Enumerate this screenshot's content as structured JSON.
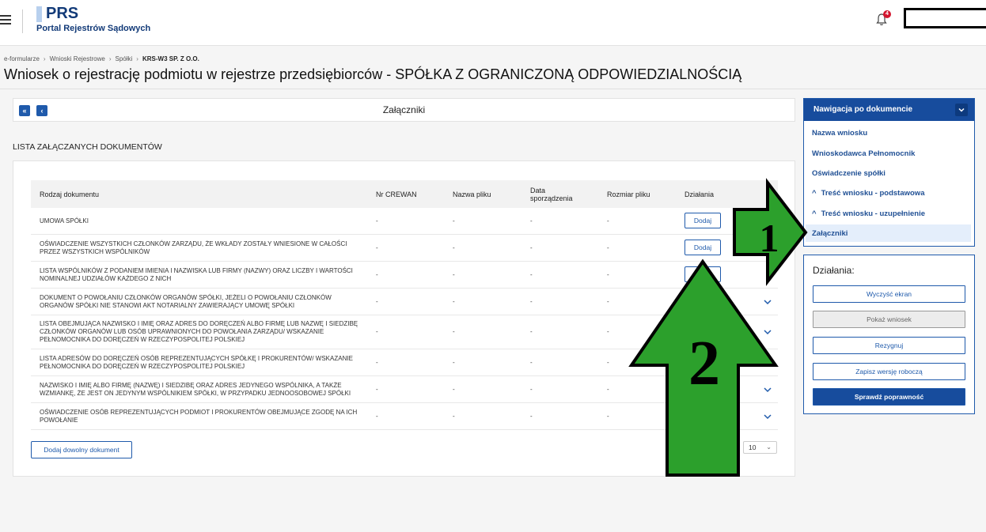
{
  "header": {
    "logo_title": "PRS",
    "logo_subtitle": "Portal Rejestrów Sądowych",
    "notification_count": "4"
  },
  "breadcrumb": [
    "e-formularze",
    "Wnioski Rejestrowe",
    "Spółki",
    "KRS-W3 SP. Z O.O."
  ],
  "page_title": "Wniosek o rejestrację podmiotu w rejestrze przedsiębiorców - SPÓŁKA Z OGRANICZONĄ ODPOWIEDZIALNOŚCIĄ",
  "section": {
    "title": "Załączniki",
    "first_icon": "«",
    "prev_icon": "‹"
  },
  "list_heading": "LISTA ZAŁĄCZANYCH DOKUMENTÓW",
  "table": {
    "columns": [
      "Rodzaj dokumentu",
      "Nr CREWAN",
      "Nazwa pliku",
      "Data sporządzenia",
      "Rozmiar pliku",
      "Działania"
    ],
    "add_label": "Dodaj",
    "rows": [
      {
        "name": "UMOWA SPÓŁKI",
        "crewan": "-",
        "file": "-",
        "date": "-",
        "size": "-"
      },
      {
        "name": "OŚWIADCZENIE WSZYSTKICH CZŁONKÓW ZARZĄDU, ŻE WKŁADY ZOSTAŁY WNIESIONE W CAŁOŚCI PRZEZ WSZYSTKICH WSPÓLNIKÓW",
        "crewan": "-",
        "file": "-",
        "date": "-",
        "size": "-"
      },
      {
        "name": "LISTA WSPÓLNIKÓW Z PODANIEM IMIENIA I NAZWISKA LUB FIRMY (NAZWY) ORAZ LICZBY I WARTOŚCI NOMINALNEJ UDZIAŁÓW KAŻDEGO Z NICH",
        "crewan": "-",
        "file": "-",
        "date": "-",
        "size": "-"
      },
      {
        "name": "DOKUMENT O POWOŁANIU CZŁONKÓW ORGANÓW SPÓŁKI, JEŻELI O POWOŁANIU CZŁONKÓW ORGANÓW SPÓŁKI NIE STANOWI AKT NOTARIALNY ZAWIERAJĄCY UMOWĘ SPÓŁKI",
        "crewan": "-",
        "file": "-",
        "date": "-",
        "size": "-"
      },
      {
        "name": "LISTA OBEJMUJĄCA NAZWISKO I IMIĘ ORAZ ADRES DO DORĘCZEŃ ALBO FIRMĘ LUB NAZWĘ I SIEDZIBĘ CZŁONKÓW ORGANÓW LUB OSÓB UPRAWNIONYCH DO POWOŁANIA ZARZĄDU/ WSKAZANIE PEŁNOMOCNIKA DO DORĘCZEŃ W RZECZYPOSPOLITEJ POLSKIEJ",
        "crewan": "-",
        "file": "-",
        "date": "-",
        "size": "-"
      },
      {
        "name": "LISTA ADRESÓW DO DORĘCZEŃ OSÓB REPREZENTUJĄCYCH SPÓŁKĘ I PROKURENTÓW/ WSKAZANIE PEŁNOMOCNIKA DO DORĘCZEŃ W RZECZYPOSPOLITEJ POLSKIEJ",
        "crewan": "-",
        "file": "-",
        "date": "-",
        "size": "-"
      },
      {
        "name": "NAZWISKO I IMIĘ ALBO FIRMĘ (NAZWĘ) I SIEDZIBĘ ORAZ ADRES JEDYNEGO WSPÓLNIKA, A TAKŻE WZMIANKĘ, ŻE JEST ON JEDYNYM WSPÓLNIKIEM SPÓŁKI, W PRZYPADKU JEDNOOSOBOWEJ SPÓŁKI",
        "crewan": "-",
        "file": "-",
        "date": "-",
        "size": "-"
      },
      {
        "name": "OŚWIADCZENIE OSÓB REPREZENTUJĄCYCH PODMIOT I PROKURENTÓW OBEJMUJĄCE ZGODĘ NA ICH POWOŁANIE",
        "crewan": "-",
        "file": "-",
        "date": "-",
        "size": "-"
      }
    ],
    "add_any_label": "Dodaj dowolny dokument",
    "page_size": "10"
  },
  "nav_panel": {
    "title": "Nawigacja po dokumencie",
    "items": [
      {
        "label": "Nazwa wniosku"
      },
      {
        "label": "Wnioskodawca Pełnomocnik"
      },
      {
        "label": "Oświadczenie spółki"
      },
      {
        "label": "Treść wniosku - podstawowa",
        "expand": "^"
      },
      {
        "label": "Treść wniosku - uzupełnienie",
        "expand": "^"
      },
      {
        "label": "Załączniki"
      }
    ]
  },
  "actions_panel": {
    "title": "Działania:",
    "buttons": [
      "Wyczyść ekran",
      "Pokaż wniosek",
      "Rezygnuj",
      "Zapisz wersję roboczą",
      "Sprawdź poprawność"
    ]
  },
  "annotations": {
    "arrow1_label": "1",
    "arrow2_label": "2",
    "arrow_color": "#2ca02c"
  }
}
